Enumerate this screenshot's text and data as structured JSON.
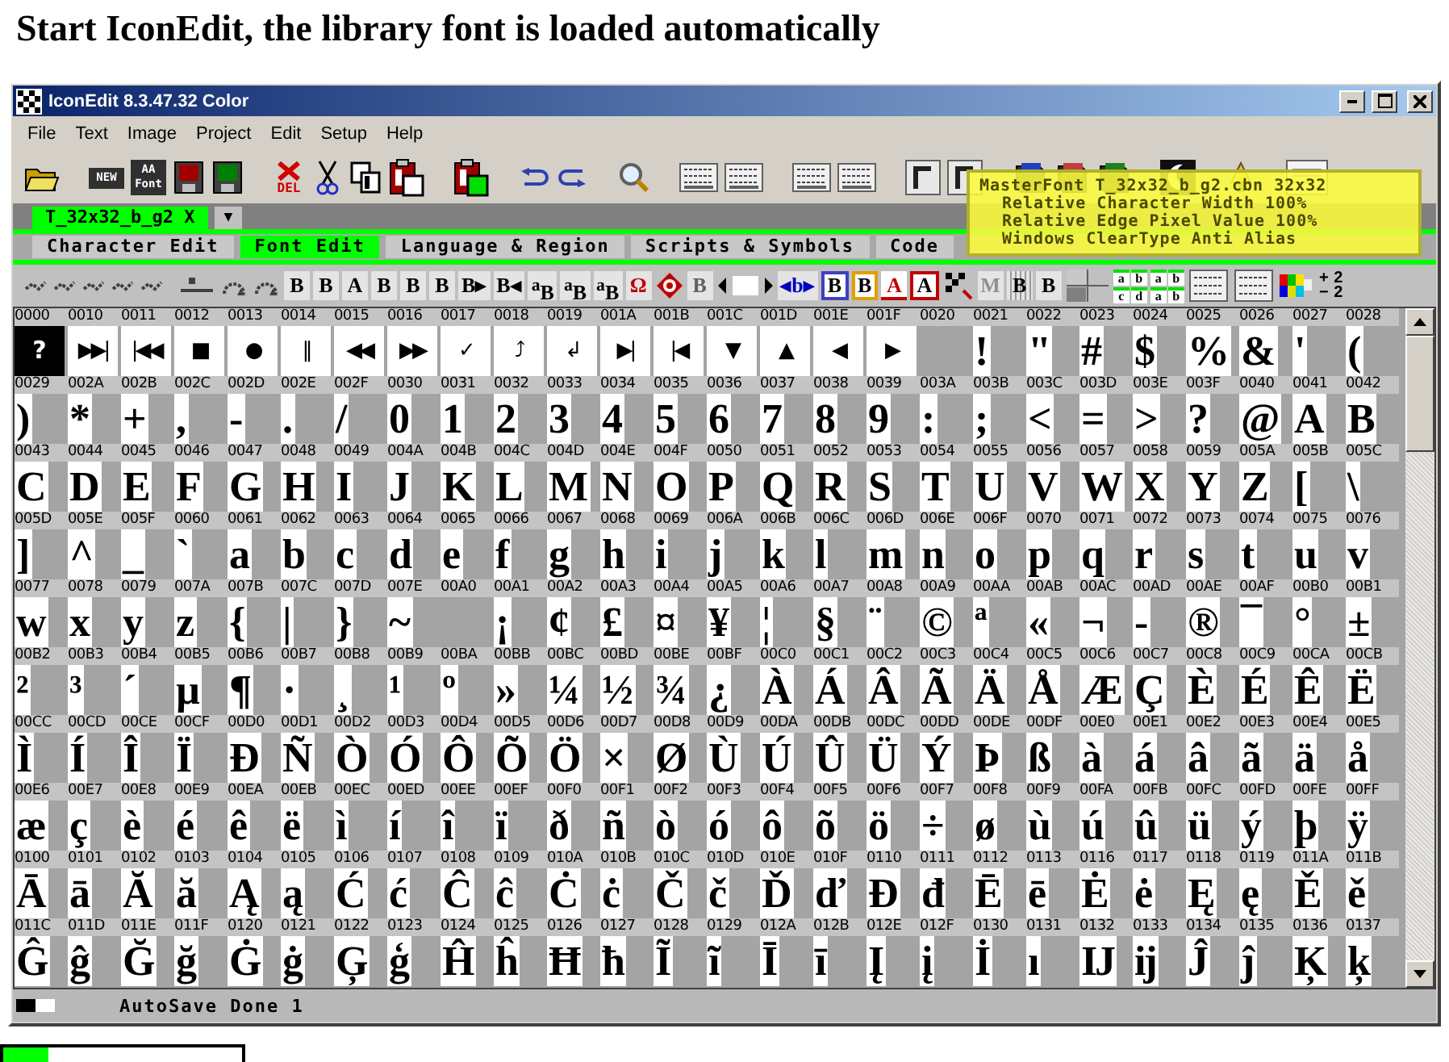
{
  "heading": "Start IconEdit, the library font is loaded automatically",
  "window": {
    "title": "IconEdit 8.3.47.32 Color"
  },
  "menu": [
    "File",
    "Text",
    "Image",
    "Project",
    "Edit",
    "Setup",
    "Help"
  ],
  "toolbar": [
    [
      {
        "kind": "folder"
      }
    ],
    [
      {
        "kind": "badge",
        "text": "NEW"
      },
      {
        "kind": "badge",
        "text": "AA Font"
      },
      {
        "kind": "disk",
        "color": "#a00000"
      },
      {
        "kind": "disk",
        "color": "#008000"
      }
    ],
    [
      {
        "kind": "delete",
        "text": "DEL"
      },
      {
        "kind": "scissors"
      },
      {
        "kind": "copy"
      },
      {
        "kind": "paste",
        "color": "#ffffff"
      }
    ],
    [
      {
        "kind": "paste",
        "color": "#00e000"
      }
    ],
    [
      {
        "kind": "undo"
      },
      {
        "kind": "redo"
      }
    ],
    [
      {
        "kind": "magnifier"
      }
    ],
    [
      {
        "kind": "panel"
      },
      {
        "kind": "panel"
      }
    ],
    [
      {
        "kind": "panel"
      },
      {
        "kind": "panel"
      }
    ],
    [
      {
        "kind": "frame"
      },
      {
        "kind": "frame"
      }
    ],
    [
      {
        "kind": "book",
        "color": "#2040c0"
      },
      {
        "kind": "book",
        "color": "#c04040"
      },
      {
        "kind": "book",
        "color": "#208020"
      }
    ],
    [
      {
        "kind": "moon"
      }
    ],
    [
      {
        "kind": "lamp"
      }
    ],
    [
      {
        "kind": "doc"
      }
    ]
  ],
  "file_tabs": {
    "tabs": [
      {
        "label": "T_32x32_b_g2 X",
        "selected": true
      }
    ],
    "dropdown": "▼"
  },
  "mode_tabs": [
    {
      "label": "Character Edit",
      "selected": false
    },
    {
      "label": "Font Edit",
      "selected": true
    },
    {
      "label": "Language & Region",
      "selected": false
    },
    {
      "label": "Scripts & Symbols",
      "selected": false
    },
    {
      "label": "Code",
      "selected": false
    }
  ],
  "tooltip": [
    "MasterFont T_32x32_b_g2.cbn 32x32",
    "Relative Character Width 100%",
    "Relative Edge Pixel Value 100%",
    "Windows ClearType Anti Alias"
  ],
  "format_toolbar": [
    [
      {
        "kind": "arrows"
      },
      {
        "kind": "arrows"
      },
      {
        "kind": "arrows"
      },
      {
        "kind": "arrows"
      },
      {
        "kind": "arrows"
      }
    ],
    [
      {
        "kind": "line"
      },
      {
        "kind": "curve"
      },
      {
        "kind": "curve"
      },
      {
        "kind": "letter",
        "text": "B"
      },
      {
        "kind": "letter",
        "text": "B"
      },
      {
        "kind": "letter",
        "text": "A"
      },
      {
        "kind": "letter",
        "text": "B"
      },
      {
        "kind": "letter",
        "text": "B"
      },
      {
        "kind": "letter",
        "text": "B"
      },
      {
        "kind": "letter",
        "text": "B▸"
      },
      {
        "kind": "letter",
        "text": "B◂"
      },
      {
        "kind": "letter",
        "text": "$^{a}$B"
      },
      {
        "kind": "letter",
        "text": "$^{a}$B"
      },
      {
        "kind": "letter",
        "text": "$^{a}$B"
      },
      {
        "kind": "letter",
        "text": "Ω",
        "color": "#c00000"
      },
      {
        "kind": "help"
      },
      {
        "kind": "letter",
        "text": "B",
        "color": "#606060"
      },
      {
        "kind": "width"
      },
      {
        "kind": "letter",
        "text": "◂b▸",
        "color": "#0000c0"
      },
      {
        "kind": "boxed",
        "text": "B",
        "color": "#4040c0"
      },
      {
        "kind": "boxed",
        "text": "B",
        "color": "#e0a000"
      },
      {
        "kind": "underlined",
        "text": "A",
        "color": "#c00000"
      },
      {
        "kind": "boxed",
        "text": "A",
        "color": "#c00000"
      },
      {
        "kind": "checker"
      },
      {
        "kind": "letter",
        "text": "M",
        "color": "#909090"
      },
      {
        "kind": "dotted",
        "text": "B"
      },
      {
        "kind": "letter",
        "text": "B"
      },
      {
        "kind": "cross"
      },
      {
        "kind": "quad",
        "texts": [
          "a",
          "b",
          "c",
          "d"
        ]
      },
      {
        "kind": "quad",
        "texts": [
          "a",
          "b",
          "a",
          "b"
        ]
      },
      {
        "kind": "panel"
      },
      {
        "kind": "panel"
      },
      {
        "kind": "colors"
      },
      {
        "kind": "fraction",
        "texts": [
          "+",
          "2",
          "−",
          "2"
        ]
      }
    ]
  ],
  "grid": {
    "segments": [
      {
        "kind": "replacement",
        "cells": [
          {
            "code": "0000",
            "glyph": "?"
          }
        ]
      },
      {
        "kind": "symbols",
        "cells": [
          {
            "code": "0010",
            "glyph": "▶▶|"
          },
          {
            "code": "0011",
            "glyph": "|◀◀"
          },
          {
            "code": "0012",
            "glyph": "■"
          },
          {
            "code": "0013",
            "glyph": "●"
          },
          {
            "code": "0014",
            "glyph": "‖"
          },
          {
            "code": "0015",
            "glyph": "◀◀"
          },
          {
            "code": "0016",
            "glyph": "▶▶"
          },
          {
            "code": "0017",
            "glyph": "✓"
          },
          {
            "code": "0018",
            "glyph": "⤴"
          },
          {
            "code": "0019",
            "glyph": "↲"
          },
          {
            "code": "001A",
            "glyph": "▶|"
          },
          {
            "code": "001B",
            "glyph": "|◀"
          },
          {
            "code": "001C",
            "glyph": "▼"
          },
          {
            "code": "001D",
            "glyph": "▲"
          },
          {
            "code": "001E",
            "glyph": "◀"
          },
          {
            "code": "001F",
            "glyph": "▶"
          }
        ]
      },
      {
        "kind": "characters",
        "cells": [
          {
            "code": "0020"
          },
          {
            "code": "0021",
            "glyph": "!"
          },
          {
            "code": "0022",
            "glyph": "\""
          },
          {
            "code": "0023",
            "glyph": "#"
          },
          {
            "code": "0024",
            "glyph": "$"
          },
          {
            "code": "0025",
            "glyph": "%"
          },
          {
            "code": "0026",
            "glyph": "&"
          },
          {
            "code": "0027",
            "glyph": "'"
          },
          {
            "code": "0028",
            "glyph": "("
          },
          {
            "code": "0029",
            "glyph": ")"
          },
          {
            "code": "002A",
            "glyph": "*"
          },
          {
            "code": "002B",
            "glyph": "+"
          },
          {
            "code": "002C",
            "glyph": ","
          },
          {
            "code": "002D",
            "glyph": "-"
          },
          {
            "code": "002E",
            "glyph": "."
          },
          {
            "code": "002F",
            "glyph": "/"
          },
          {
            "code": "0030",
            "glyph": "0"
          },
          {
            "code": "0031",
            "glyph": "1"
          },
          {
            "code": "0032",
            "glyph": "2"
          },
          {
            "code": "0033",
            "glyph": "3"
          },
          {
            "code": "0034",
            "glyph": "4"
          },
          {
            "code": "0035",
            "glyph": "5"
          },
          {
            "code": "0036",
            "glyph": "6"
          },
          {
            "code": "0037",
            "glyph": "7"
          },
          {
            "code": "0038",
            "glyph": "8"
          },
          {
            "code": "0039",
            "glyph": "9"
          },
          {
            "code": "003A",
            "glyph": ":"
          },
          {
            "code": "003B",
            "glyph": ";"
          },
          {
            "code": "003C",
            "glyph": "<"
          },
          {
            "code": "003D",
            "glyph": "="
          },
          {
            "code": "003E",
            "glyph": ">"
          },
          {
            "code": "003F",
            "glyph": "?"
          },
          {
            "code": "0040",
            "glyph": "@"
          },
          {
            "code": "0041",
            "glyph": "A"
          },
          {
            "code": "0042",
            "glyph": "B"
          },
          {
            "code": "0043",
            "glyph": "C"
          },
          {
            "code": "0044",
            "glyph": "D"
          },
          {
            "code": "0045",
            "glyph": "E"
          },
          {
            "code": "0046",
            "glyph": "F"
          },
          {
            "code": "0047",
            "glyph": "G"
          },
          {
            "code": "0048",
            "glyph": "H"
          },
          {
            "code": "0049",
            "glyph": "I"
          },
          {
            "code": "004A",
            "glyph": "J"
          },
          {
            "code": "004B",
            "glyph": "K"
          },
          {
            "code": "004C",
            "glyph": "L"
          },
          {
            "code": "004D",
            "glyph": "M"
          },
          {
            "code": "004E",
            "glyph": "N"
          },
          {
            "code": "004F",
            "glyph": "O"
          },
          {
            "code": "0050",
            "glyph": "P"
          },
          {
            "code": "0051",
            "glyph": "Q"
          },
          {
            "code": "0052",
            "glyph": "R"
          },
          {
            "code": "0053",
            "glyph": "S"
          },
          {
            "code": "0054",
            "glyph": "T"
          },
          {
            "code": "0055",
            "glyph": "U"
          },
          {
            "code": "0056",
            "glyph": "V"
          },
          {
            "code": "0057",
            "glyph": "W"
          },
          {
            "code": "0058",
            "glyph": "X"
          },
          {
            "code": "0059",
            "glyph": "Y"
          },
          {
            "code": "005A",
            "glyph": "Z"
          },
          {
            "code": "005B",
            "glyph": "["
          },
          {
            "code": "005C",
            "glyph": "\\"
          },
          {
            "code": "005D",
            "glyph": "]"
          },
          {
            "code": "005E",
            "glyph": "^"
          },
          {
            "code": "005F",
            "glyph": "_"
          },
          {
            "code": "0060",
            "glyph": "`"
          },
          {
            "code": "0061",
            "glyph": "a"
          },
          {
            "code": "0062",
            "glyph": "b"
          },
          {
            "code": "0063",
            "glyph": "c"
          },
          {
            "code": "0064",
            "glyph": "d"
          },
          {
            "code": "0065",
            "glyph": "e"
          },
          {
            "code": "0066",
            "glyph": "f"
          },
          {
            "code": "0067",
            "glyph": "g"
          },
          {
            "code": "0068",
            "glyph": "h"
          },
          {
            "code": "0069",
            "glyph": "i"
          },
          {
            "code": "006A",
            "glyph": "j"
          },
          {
            "code": "006B",
            "glyph": "k"
          },
          {
            "code": "006C",
            "glyph": "l"
          },
          {
            "code": "006D",
            "glyph": "m"
          },
          {
            "code": "006E",
            "glyph": "n"
          },
          {
            "code": "006F",
            "glyph": "o"
          },
          {
            "code": "0070",
            "glyph": "p"
          },
          {
            "code": "0071",
            "glyph": "q"
          },
          {
            "code": "0072",
            "glyph": "r"
          },
          {
            "code": "0073",
            "glyph": "s"
          },
          {
            "code": "0074",
            "glyph": "t"
          },
          {
            "code": "0075",
            "glyph": "u"
          },
          {
            "code": "0076",
            "glyph": "v"
          },
          {
            "code": "0077",
            "glyph": "w"
          },
          {
            "code": "0078",
            "glyph": "x"
          },
          {
            "code": "0079",
            "glyph": "y"
          },
          {
            "code": "007A",
            "glyph": "z"
          },
          {
            "code": "007B",
            "glyph": "{"
          },
          {
            "code": "007C",
            "glyph": "|"
          },
          {
            "code": "007D",
            "glyph": "}"
          },
          {
            "code": "007E",
            "glyph": "~"
          },
          {
            "code": "00A0"
          },
          {
            "code": "00A1",
            "glyph": "¡"
          },
          {
            "code": "00A2",
            "glyph": "¢"
          },
          {
            "code": "00A3",
            "glyph": "£"
          },
          {
            "code": "00A4",
            "glyph": "¤"
          },
          {
            "code": "00A5",
            "glyph": "¥"
          },
          {
            "code": "00A6",
            "glyph": "¦"
          },
          {
            "code": "00A7",
            "glyph": "§"
          },
          {
            "code": "00A8",
            "glyph": "¨"
          },
          {
            "code": "00A9",
            "glyph": "©"
          },
          {
            "code": "00AA",
            "glyph": "ª"
          },
          {
            "code": "00AB",
            "glyph": "«"
          },
          {
            "code": "00AC",
            "glyph": "¬"
          },
          {
            "code": "00AD",
            "glyph": "-"
          },
          {
            "code": "00AE",
            "glyph": "®"
          },
          {
            "code": "00AF",
            "glyph": "¯"
          },
          {
            "code": "00B0",
            "glyph": "°"
          },
          {
            "code": "00B1",
            "glyph": "±"
          },
          {
            "code": "00B2",
            "glyph": "²"
          },
          {
            "code": "00B3",
            "glyph": "³"
          },
          {
            "code": "00B4",
            "glyph": "´"
          },
          {
            "code": "00B5",
            "glyph": "µ"
          },
          {
            "code": "00B6",
            "glyph": "¶"
          },
          {
            "code": "00B7",
            "glyph": "·"
          },
          {
            "code": "00B8",
            "glyph": "¸"
          },
          {
            "code": "00B9",
            "glyph": "¹"
          },
          {
            "code": "00BA",
            "glyph": "º"
          },
          {
            "code": "00BB",
            "glyph": "»"
          },
          {
            "code": "00BC",
            "glyph": "¼"
          },
          {
            "code": "00BD",
            "glyph": "½"
          },
          {
            "code": "00BE",
            "glyph": "¾"
          },
          {
            "code": "00BF",
            "glyph": "¿"
          },
          {
            "code": "00C0",
            "glyph": "À"
          },
          {
            "code": "00C1",
            "glyph": "Á"
          },
          {
            "code": "00C2",
            "glyph": "Â"
          },
          {
            "code": "00C3",
            "glyph": "Ã"
          },
          {
            "code": "00C4",
            "glyph": "Ä"
          },
          {
            "code": "00C5",
            "glyph": "Å"
          },
          {
            "code": "00C6",
            "glyph": "Æ"
          },
          {
            "code": "00C7",
            "glyph": "Ç"
          },
          {
            "code": "00C8",
            "glyph": "È"
          },
          {
            "code": "00C9",
            "glyph": "É"
          },
          {
            "code": "00CA",
            "glyph": "Ê"
          },
          {
            "code": "00CB",
            "glyph": "Ë"
          },
          {
            "code": "00CC",
            "glyph": "Ì"
          },
          {
            "code": "00CD",
            "glyph": "Í"
          },
          {
            "code": "00CE",
            "glyph": "Î"
          },
          {
            "code": "00CF",
            "glyph": "Ï"
          },
          {
            "code": "00D0",
            "glyph": "Ð"
          },
          {
            "code": "00D1",
            "glyph": "Ñ"
          },
          {
            "code": "00D2",
            "glyph": "Ò"
          },
          {
            "code": "00D3",
            "glyph": "Ó"
          },
          {
            "code": "00D4",
            "glyph": "Ô"
          },
          {
            "code": "00D5",
            "glyph": "Õ"
          },
          {
            "code": "00D6",
            "glyph": "Ö"
          },
          {
            "code": "00D7",
            "glyph": "×"
          },
          {
            "code": "00D8",
            "glyph": "Ø"
          },
          {
            "code": "00D9",
            "glyph": "Ù"
          },
          {
            "code": "00DA",
            "glyph": "Ú"
          },
          {
            "code": "00DB",
            "glyph": "Û"
          },
          {
            "code": "00DC",
            "glyph": "Ü"
          },
          {
            "code": "00DD",
            "glyph": "Ý"
          },
          {
            "code": "00DE",
            "glyph": "Þ"
          },
          {
            "code": "00DF",
            "glyph": "ß"
          },
          {
            "code": "00E0",
            "glyph": "à"
          },
          {
            "code": "00E1",
            "glyph": "á"
          },
          {
            "code": "00E2",
            "glyph": "â"
          },
          {
            "code": "00E3",
            "glyph": "ã"
          },
          {
            "code": "00E4",
            "glyph": "ä"
          },
          {
            "code": "00E5",
            "glyph": "å"
          },
          {
            "code": "00E6",
            "glyph": "æ"
          },
          {
            "code": "00E7",
            "glyph": "ç"
          },
          {
            "code": "00E8",
            "glyph": "è"
          },
          {
            "code": "00E9",
            "glyph": "é"
          },
          {
            "code": "00EA",
            "glyph": "ê"
          },
          {
            "code": "00EB",
            "glyph": "ë"
          },
          {
            "code": "00EC",
            "glyph": "ì"
          },
          {
            "code": "00ED",
            "glyph": "í"
          },
          {
            "code": "00EE",
            "glyph": "î"
          },
          {
            "code": "00EF",
            "glyph": "ï"
          },
          {
            "code": "00F0",
            "glyph": "ð"
          },
          {
            "code": "00F1",
            "glyph": "ñ"
          },
          {
            "code": "00F2",
            "glyph": "ò"
          },
          {
            "code": "00F3",
            "glyph": "ó"
          },
          {
            "code": "00F4",
            "glyph": "ô"
          },
          {
            "code": "00F5",
            "glyph": "õ"
          },
          {
            "code": "00F6",
            "glyph": "ö"
          },
          {
            "code": "00F7",
            "glyph": "÷"
          },
          {
            "code": "00F8",
            "glyph": "ø"
          },
          {
            "code": "00F9",
            "glyph": "ù"
          },
          {
            "code": "00FA",
            "glyph": "ú"
          },
          {
            "code": "00FB",
            "glyph": "û"
          },
          {
            "code": "00FC",
            "glyph": "ü"
          },
          {
            "code": "00FD",
            "glyph": "ý"
          },
          {
            "code": "00FE",
            "glyph": "þ"
          },
          {
            "code": "00FF",
            "glyph": "ÿ"
          },
          {
            "code": "0100",
            "glyph": "Ā"
          },
          {
            "code": "0101",
            "glyph": "ā"
          },
          {
            "code": "0102",
            "glyph": "Ă"
          },
          {
            "code": "0103",
            "glyph": "ă"
          },
          {
            "code": "0104",
            "glyph": "Ą"
          },
          {
            "code": "0105",
            "glyph": "ą"
          },
          {
            "code": "0106",
            "glyph": "Ć"
          },
          {
            "code": "0107",
            "glyph": "ć"
          },
          {
            "code": "0108",
            "glyph": "Ĉ"
          },
          {
            "code": "0109",
            "glyph": "ĉ"
          },
          {
            "code": "010A",
            "glyph": "Ċ"
          },
          {
            "code": "010B",
            "glyph": "ċ"
          },
          {
            "code": "010C",
            "glyph": "Č"
          },
          {
            "code": "010D",
            "glyph": "č"
          },
          {
            "code": "010E",
            "glyph": "Ď"
          },
          {
            "code": "010F",
            "glyph": "ď"
          },
          {
            "code": "0110",
            "glyph": "Đ"
          },
          {
            "code": "0111",
            "glyph": "đ"
          },
          {
            "code": "0112",
            "glyph": "Ē"
          },
          {
            "code": "0113",
            "glyph": "ē"
          },
          {
            "code": "0116",
            "glyph": "Ė"
          },
          {
            "code": "0117",
            "glyph": "ė"
          },
          {
            "code": "0118",
            "glyph": "Ę"
          },
          {
            "code": "0119",
            "glyph": "ę"
          },
          {
            "code": "011A",
            "glyph": "Ě"
          },
          {
            "code": "011B",
            "glyph": "ě"
          },
          {
            "code": "011C",
            "glyph": "Ĝ"
          },
          {
            "code": "011D",
            "glyph": "ĝ"
          },
          {
            "code": "011E",
            "glyph": "Ğ"
          },
          {
            "code": "011F",
            "glyph": "ğ"
          },
          {
            "code": "0120",
            "glyph": "Ġ"
          },
          {
            "code": "0121",
            "glyph": "ġ"
          },
          {
            "code": "0122",
            "glyph": "Ģ"
          },
          {
            "code": "0123",
            "glyph": "ģ"
          },
          {
            "code": "0124",
            "glyph": "Ĥ"
          },
          {
            "code": "0125",
            "glyph": "ĥ"
          },
          {
            "code": "0126",
            "glyph": "Ħ"
          },
          {
            "code": "0127",
            "glyph": "ħ"
          },
          {
            "code": "0128",
            "glyph": "Ĩ"
          },
          {
            "code": "0129",
            "glyph": "ĩ"
          },
          {
            "code": "012A",
            "glyph": "Ī"
          },
          {
            "code": "012B",
            "glyph": "ī"
          },
          {
            "code": "012E",
            "glyph": "Į"
          },
          {
            "code": "012F",
            "glyph": "į"
          },
          {
            "code": "0130",
            "glyph": "İ"
          },
          {
            "code": "0131",
            "glyph": "ı"
          },
          {
            "code": "0132",
            "glyph": "Ĳ"
          },
          {
            "code": "0133",
            "glyph": "ĳ"
          },
          {
            "code": "0134",
            "glyph": "Ĵ"
          },
          {
            "code": "0135",
            "glyph": "ĵ"
          },
          {
            "code": "0136",
            "glyph": "Ķ"
          },
          {
            "code": "0137",
            "glyph": "ķ"
          }
        ]
      }
    ]
  },
  "status": {
    "text": "AutoSave Done 1"
  },
  "progress": {
    "level": 0.19
  }
}
